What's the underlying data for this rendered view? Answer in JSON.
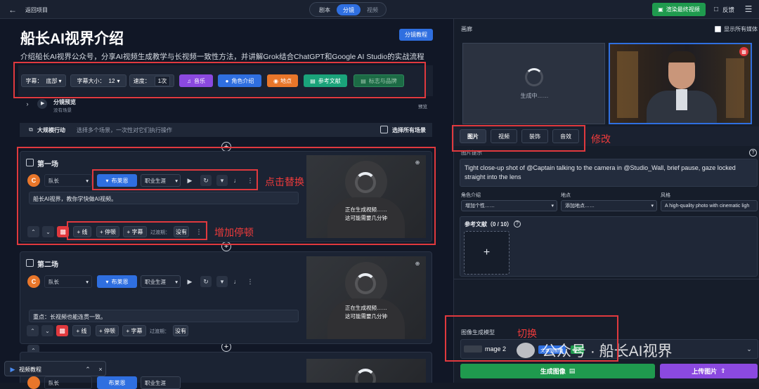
{
  "topbar": {
    "back_label": "返回项目",
    "tabs": [
      "剧本",
      "分镜",
      "视频"
    ],
    "render_button": "渲染最终视频",
    "feedback": "反馈"
  },
  "left": {
    "title": "船长AI视界介绍",
    "tutorial_button": "分镜教程",
    "desc": "介绍船长AI视界公众号，分享AI视频生成教学与长视频一致性方法，并讲解Grok结合ChatGPT和Google AI Studio的实战流程",
    "toolbar": {
      "subtitle_label": "字幕：",
      "subtitle_value": "底部",
      "fontsize_label": "字幕大小：",
      "fontsize_value": "12",
      "speed_label": "速度：",
      "speed_value": "1次",
      "music": "音乐",
      "character": "角色介绍",
      "location": "地点",
      "reference": "参考文献",
      "logo": "标志与品牌"
    },
    "preview": {
      "title": "分镜预览",
      "subtitle": "没有场景",
      "tag": "预览"
    },
    "bulk": {
      "title": "大规模行动",
      "hint": "选择多个场景，一次性对它们执行操作",
      "select_all": "选择所有场景"
    },
    "scenes": [
      {
        "title": "第一场",
        "avatar": "C",
        "character": "队长",
        "voice_button": "布莱恩",
        "voice_style": "职业生涯",
        "text": "船长AI视界，教你学快做AI视频。",
        "actions": [
          "+ 线",
          "+ 停顿",
          "+ 字幕"
        ],
        "transition_label": "过渡期：",
        "transition_value": "没有",
        "status_line1": "正在生成视频……",
        "status_line2": "这可能需要几分钟"
      },
      {
        "title": "第二场",
        "avatar": "C",
        "character": "队长",
        "voice_button": "布莱恩",
        "voice_style": "职业生涯",
        "text": "重点：长视频也能连贯一致。",
        "actions": [
          "+ 线",
          "+ 停顿",
          "+ 字幕"
        ],
        "transition_label": "过渡期：",
        "transition_value": "没有",
        "status_line1": "正在生成视频……",
        "status_line2": "这可能需要几分钟"
      },
      {
        "character": "队长",
        "voice_button": "布莱恩",
        "voice_style": "职业生涯"
      }
    ],
    "tutorial_popup": "视频教程"
  },
  "right": {
    "gallery_label": "画廊",
    "show_all_media": "显示所有媒体",
    "generating": "生成中……",
    "tabs": [
      "图片",
      "视频",
      "装饰",
      "音效"
    ],
    "prompt_label": "图片提示",
    "prompt_text": "Tight close-up shot of @Captain talking to the camera in @Studio_Wall, brief pause, gaze locked straight into the lens",
    "character_label": "角色介绍",
    "character_value": "增加个性……",
    "location_label": "地点",
    "location_value": "添加地点……",
    "style_label": "风格",
    "style_value": "A high-quality photo with cinematic ligh",
    "reference_label": "参考文献（0 / 10）",
    "model_label": "图像生成模型",
    "model_value": "mage 2",
    "model_tag1": "文本到图像",
    "model_tag2": "参考",
    "generate_button": "生成图像",
    "upload_button": "上传图片"
  },
  "annotations": {
    "modify": "修改",
    "click_replace": "点击替换",
    "add_pause": "增加停顿",
    "switch": "切换"
  },
  "watermark": "公众号 · 船长AI视界",
  "colors": {
    "primary": "#2f6fe0",
    "green": "#1f9a4e",
    "purple": "#8b49e0",
    "red": "#e0393e",
    "annotation": "#ef3b3b"
  }
}
